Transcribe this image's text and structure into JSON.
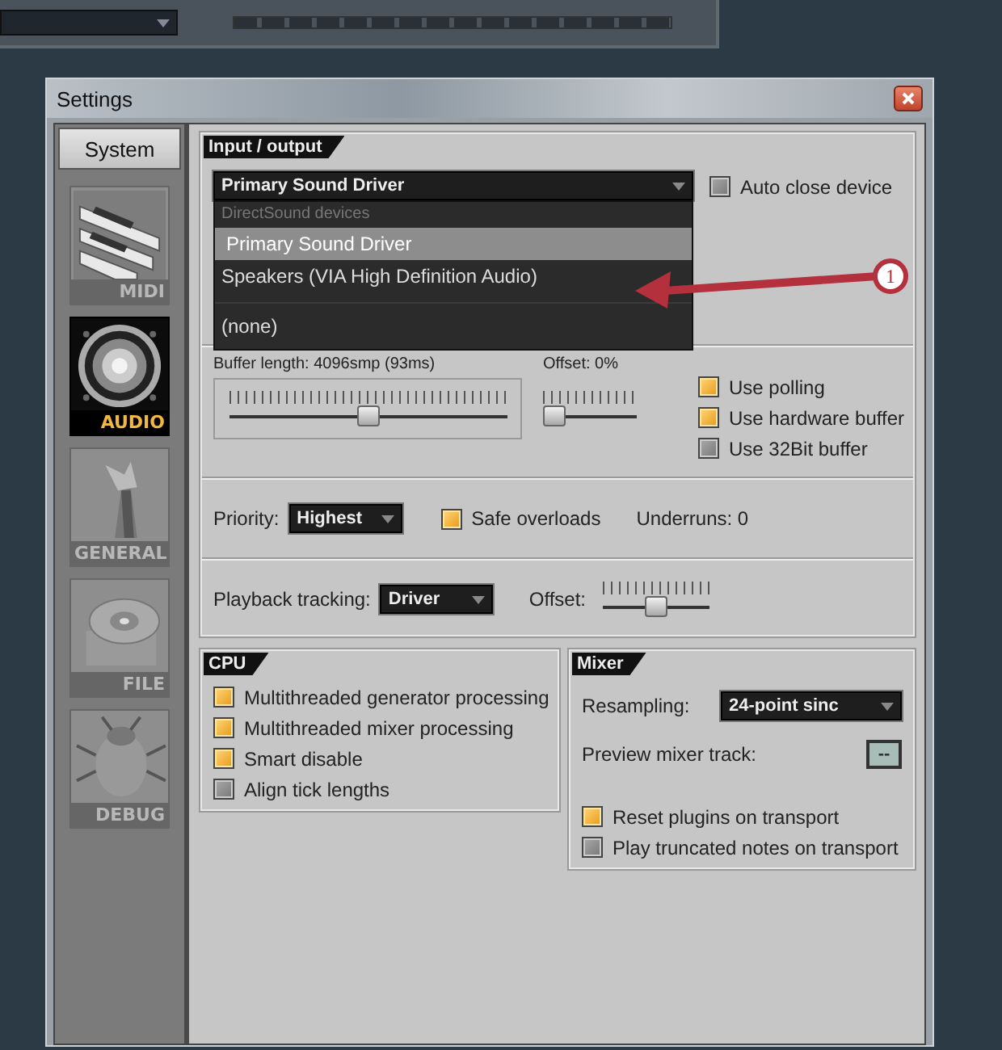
{
  "window": {
    "title": "Settings"
  },
  "sidebar": {
    "tab": "System",
    "items": [
      {
        "label": "MIDI",
        "kind": "midi",
        "selected": false
      },
      {
        "label": "AUDIO",
        "kind": "audio",
        "selected": true
      },
      {
        "label": "GENERAL",
        "kind": "general",
        "selected": false
      },
      {
        "label": "FILE",
        "kind": "file",
        "selected": false
      },
      {
        "label": "DEBUG",
        "kind": "debug",
        "selected": false
      }
    ]
  },
  "input_output": {
    "title": "Input / output",
    "device": {
      "value": "Primary Sound Driver",
      "expanded": true,
      "options_header": "DirectSound devices",
      "options": [
        {
          "label": "Primary Sound Driver",
          "selected": true
        },
        {
          "label": "Speakers (VIA High Definition Audio)",
          "selected": false
        },
        {
          "label": "(none)",
          "selected": false
        }
      ]
    },
    "auto_close": {
      "label": "Auto close device",
      "checked": false
    },
    "buffer": {
      "label": "Buffer length: 4096smp (93ms)",
      "level": 0.5
    },
    "offset": {
      "label": "Offset: 0%",
      "level": 0
    },
    "options": [
      {
        "label": "Use polling",
        "checked": true
      },
      {
        "label": "Use hardware buffer",
        "checked": true
      },
      {
        "label": "Use 32Bit buffer",
        "checked": false
      }
    ],
    "priority": {
      "label": "Priority:",
      "value": "Highest"
    },
    "safe_overloads": {
      "label": "Safe overloads",
      "checked": true
    },
    "underruns": "Underruns: 0",
    "playback": {
      "label": "Playback tracking:",
      "value": "Driver"
    },
    "playback_offset": {
      "label": "Offset:",
      "level": 0.5
    }
  },
  "cpu": {
    "title": "CPU",
    "options": [
      {
        "label": "Multithreaded generator processing",
        "checked": true
      },
      {
        "label": "Multithreaded mixer processing",
        "checked": true
      },
      {
        "label": "Smart disable",
        "checked": true
      },
      {
        "label": "Align tick lengths",
        "checked": false
      }
    ]
  },
  "mixer": {
    "title": "Mixer",
    "resampling": {
      "label": "Resampling:",
      "value": "24-point sinc"
    },
    "preview": {
      "label": "Preview mixer track:",
      "value": "--"
    },
    "options": [
      {
        "label": "Reset plugins on transport",
        "checked": true
      },
      {
        "label": "Play truncated notes on transport",
        "checked": false
      }
    ]
  },
  "annotation": {
    "label": "1"
  }
}
